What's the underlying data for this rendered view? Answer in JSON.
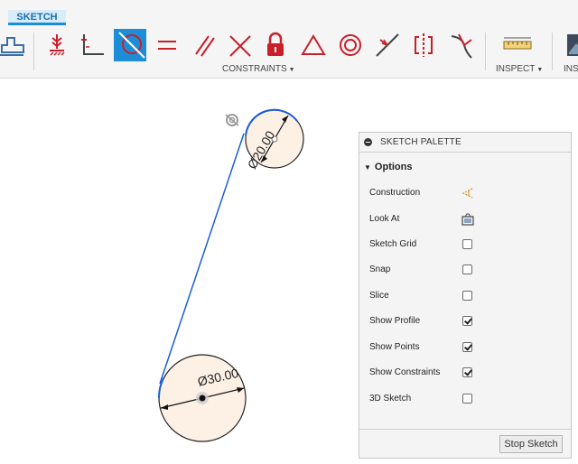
{
  "toolbar": {
    "tab_label": "SKETCH",
    "constraints_label": "CONSTRAINTS",
    "inspect_label": "INSPECT",
    "insert_label": "INS",
    "accent_color": "#1d8dd8",
    "icon_red": "#c8202a",
    "tools": [
      {
        "name": "finish-profile-icon"
      },
      {
        "name": "fix-unfix-icon"
      },
      {
        "name": "perpendicular-dimension-icon"
      },
      {
        "name": "tangent-icon",
        "active": true
      },
      {
        "name": "equal-icon"
      },
      {
        "name": "parallel-icon"
      },
      {
        "name": "perpendicular-icon"
      },
      {
        "name": "lock-icon"
      },
      {
        "name": "triangle-icon"
      },
      {
        "name": "concentric-icon"
      },
      {
        "name": "midpoint-icon"
      },
      {
        "name": "symmetry-icon"
      },
      {
        "name": "curvature-icon"
      },
      {
        "name": "measure-icon"
      },
      {
        "name": "insert-image-icon"
      }
    ]
  },
  "canvas": {
    "small_circle_dim": "Ø20.00",
    "large_circle_dim": "Ø30.00",
    "line_color": "#1a5fd6",
    "fill_color": "#fdf1e6"
  },
  "palette": {
    "title": "SKETCH PALETTE",
    "section": "Options",
    "options": [
      {
        "label": "Construction",
        "control": "construction-icon"
      },
      {
        "label": "Look At",
        "control": "look-at-icon"
      },
      {
        "label": "Sketch Grid",
        "control": "checkbox",
        "checked": false
      },
      {
        "label": "Snap",
        "control": "checkbox",
        "checked": false
      },
      {
        "label": "Slice",
        "control": "checkbox",
        "checked": false
      },
      {
        "label": "Show Profile",
        "control": "checkbox",
        "checked": true
      },
      {
        "label": "Show Points",
        "control": "checkbox",
        "checked": true
      },
      {
        "label": "Show Constraints",
        "control": "checkbox",
        "checked": true
      },
      {
        "label": "3D Sketch",
        "control": "checkbox",
        "checked": false
      }
    ],
    "stop_button": "Stop Sketch"
  }
}
